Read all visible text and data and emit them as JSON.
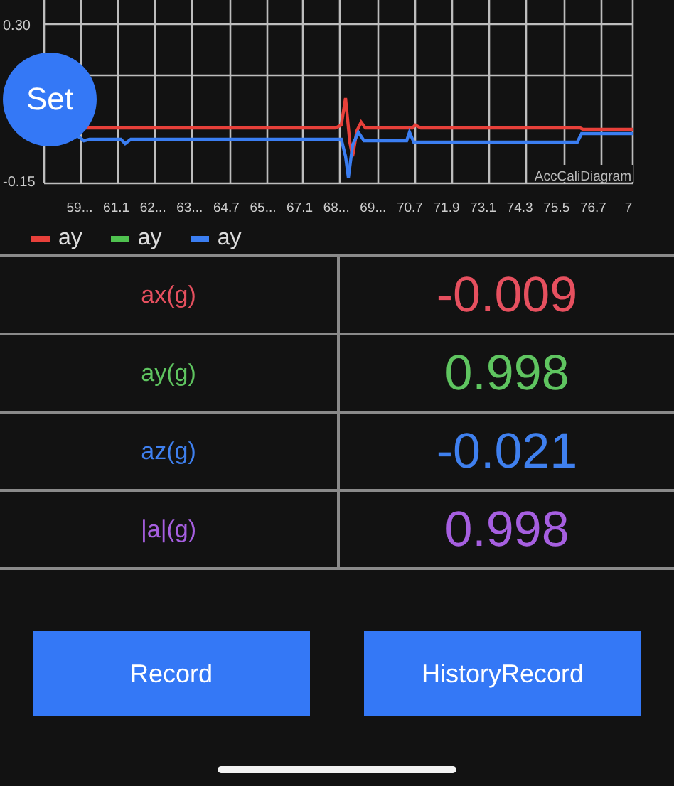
{
  "chart": {
    "y_labels": [
      "0.30",
      "-0.15"
    ],
    "x_labels": [
      "59...",
      "61.1",
      "62...",
      "63...",
      "64.7",
      "65...",
      "67.1",
      "68...",
      "69...",
      "70.7",
      "71.9",
      "73.1",
      "74.3",
      "75.5",
      "76.7",
      "7"
    ],
    "watermark": "AccCaliDiagram"
  },
  "set_button": "Set",
  "legend": [
    {
      "label": "ay",
      "color": "#e8403a"
    },
    {
      "label": "ay",
      "color": "#4fc24f"
    },
    {
      "label": "ay",
      "color": "#3b7ef2"
    }
  ],
  "readings": [
    {
      "label": "ax(g)",
      "value": "-0.009",
      "color": "#e6505f"
    },
    {
      "label": "ay(g)",
      "value": "0.998",
      "color": "#5fc560"
    },
    {
      "label": "az(g)",
      "value": "-0.021",
      "color": "#3f80ef"
    },
    {
      "label": "|a|(g)",
      "value": "0.998",
      "color": "#a65fe0"
    }
  ],
  "buttons": [
    "Record",
    "HistoryRecord"
  ]
}
